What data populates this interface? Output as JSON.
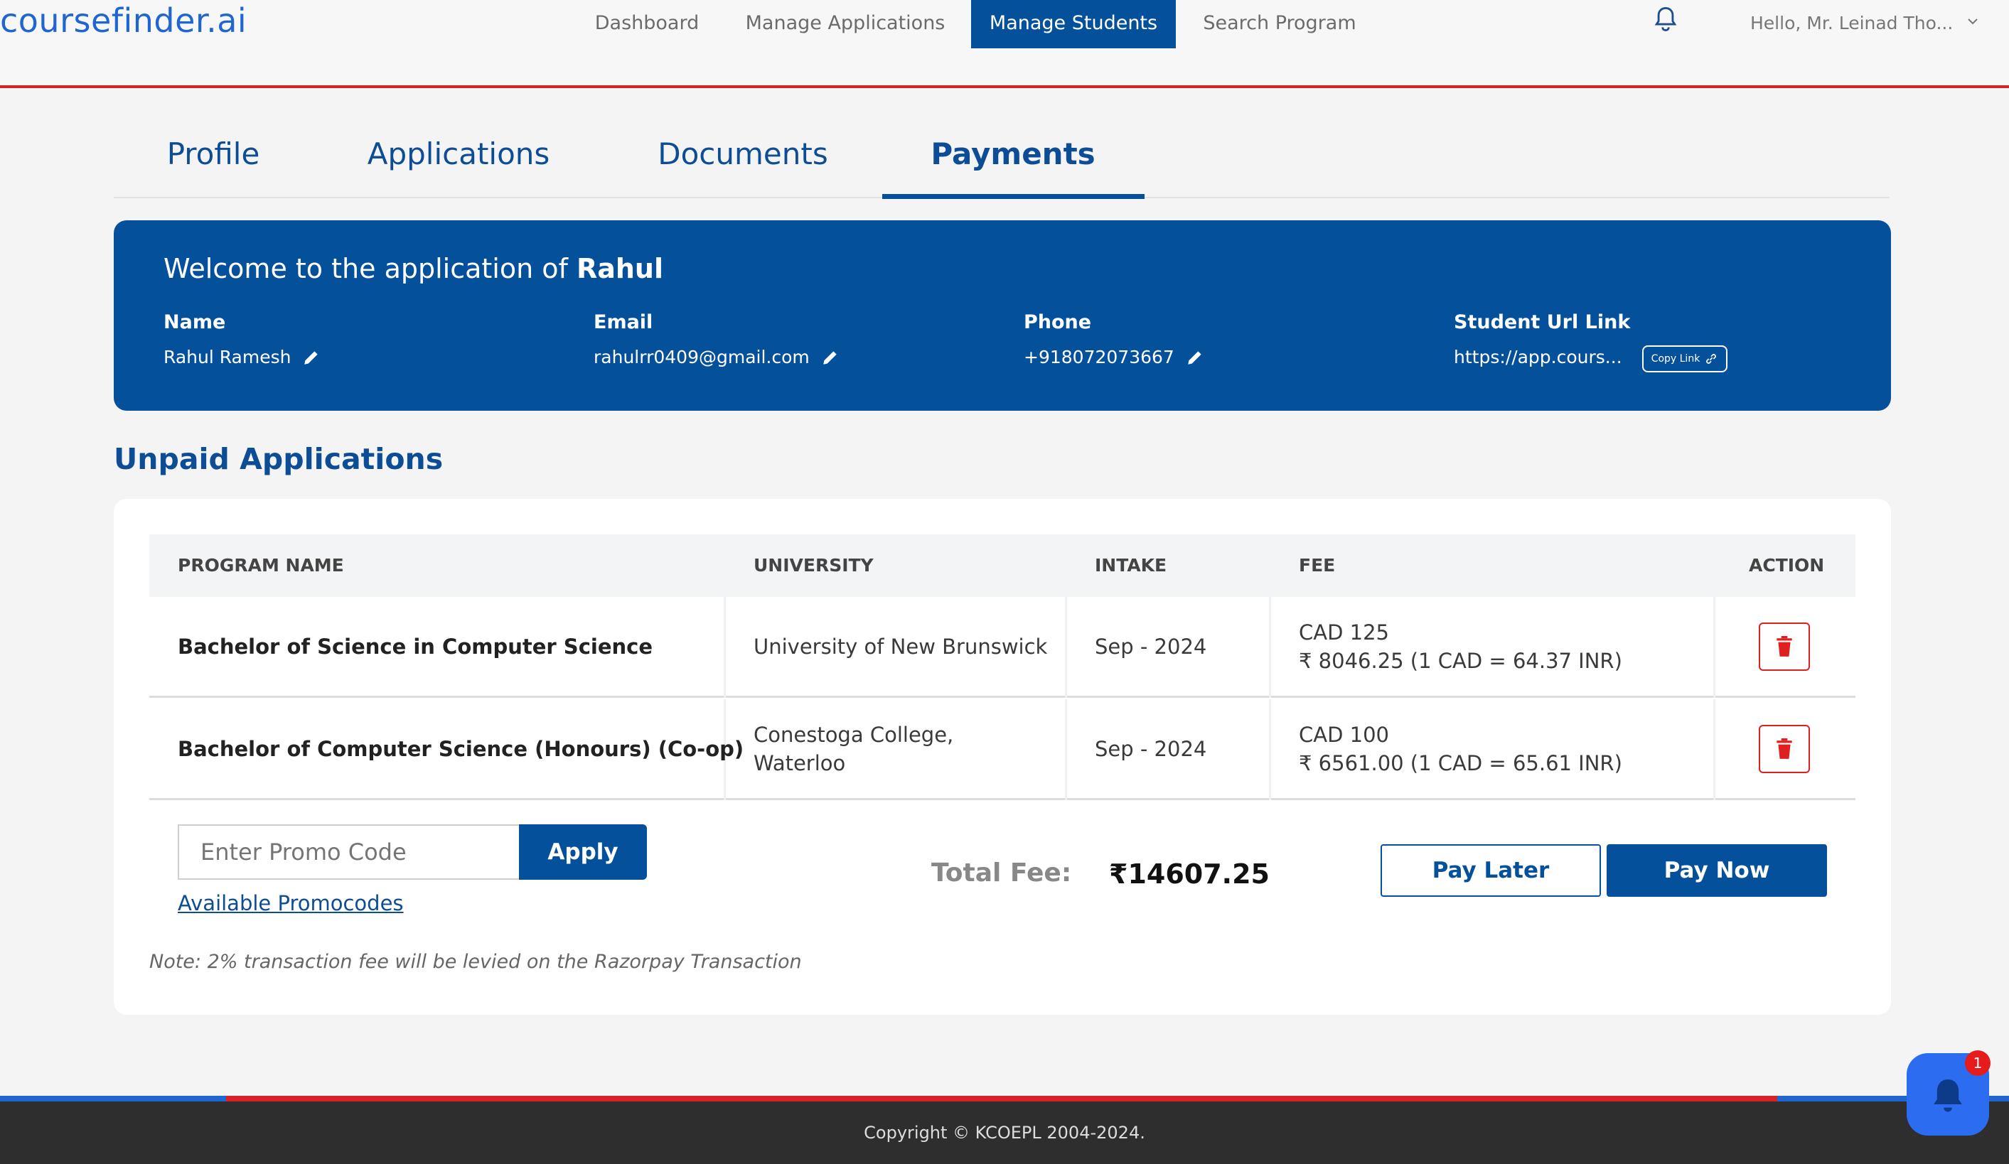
{
  "brand": {
    "logo": "coursefinder.ai",
    "color": "#1f66d1",
    "accent": "#05509b",
    "line_color": "#d6232a"
  },
  "nav": {
    "items": [
      "Dashboard",
      "Manage Applications",
      "Manage Students",
      "Search Program"
    ],
    "active": "Manage Students",
    "greeting": "Hello,  Mr. Leinad Tho...",
    "icons": [
      "bell-icon",
      "chevron-down-icon"
    ]
  },
  "tabs": {
    "items": [
      "Profile",
      "Applications",
      "Documents",
      "Payments"
    ],
    "active": "Payments"
  },
  "student": {
    "welcome_prefix": "Welcome to the application of ",
    "welcome_name": "Rahul",
    "name_label": "Name",
    "name": "Rahul Ramesh",
    "email_label": "Email",
    "email": "rahulrr0409@gmail.com",
    "phone_label": "Phone",
    "phone": "+918072073667",
    "url_label": "Student Url Link",
    "url": "https://app.cours...",
    "copy_label": "Copy Link"
  },
  "unpaid": {
    "title": "Unpaid Applications",
    "columns": [
      "PROGRAM NAME",
      "UNIVERSITY",
      "INTAKE",
      "FEE",
      "ACTION"
    ],
    "rows": [
      {
        "program": "Bachelor of Science in Computer Science",
        "university": "University of New Brunswick",
        "university_line2": "",
        "intake": "Sep - 2024",
        "fee": "CAD 125",
        "fee_inr": "₹ 8046.25 (1 CAD = 64.37 INR)"
      },
      {
        "program": "Bachelor of Computer Science (Honours) (Co-op)",
        "university": "Conestoga College,",
        "university_line2": "Waterloo",
        "intake": "Sep - 2024",
        "fee": "CAD 100",
        "fee_inr": "₹ 6561.00 (1 CAD = 65.61 INR)"
      }
    ],
    "promo_placeholder": "Enter Promo Code",
    "apply_label": "Apply",
    "available_label": "Available Promocodes",
    "total_label": "Total Fee:",
    "total_value": "₹14607.25",
    "pay_later_label": "Pay Later",
    "pay_now_label": "Pay Now",
    "note": "Note: 2% transaction fee will be levied on the Razorpay Transaction"
  },
  "footer": {
    "copyright": "Copyright © KCOEPL 2004-2024."
  },
  "chat": {
    "badge": "1"
  }
}
